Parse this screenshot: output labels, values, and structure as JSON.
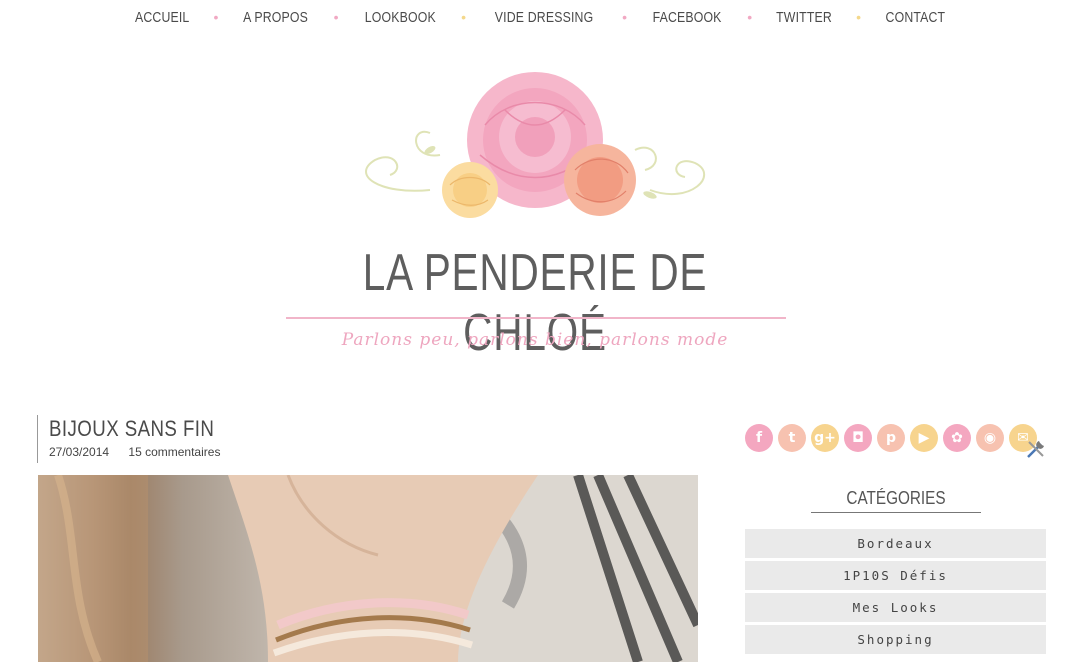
{
  "nav": {
    "items": [
      {
        "label": "ACCUEIL",
        "dot": "pink"
      },
      {
        "label": "A PROPOS",
        "dot": "pink"
      },
      {
        "label": "LOOKBOOK",
        "dot": "yellow"
      },
      {
        "label": "VIDE DRESSING",
        "dot": "pink"
      },
      {
        "label": "FACEBOOK",
        "dot": "pink"
      },
      {
        "label": "TWITTER",
        "dot": "yellow"
      },
      {
        "label": "CONTACT",
        "dot": null
      }
    ],
    "dot_glyph": "•"
  },
  "header": {
    "site_title": "LA PENDERIE DE CHLOÉ",
    "tagline": "Parlons peu, parlons bien, parlons mode"
  },
  "post": {
    "title": "BIJOUX SANS FIN",
    "date": "27/03/2014",
    "comments": "15 commentaires"
  },
  "sidebar": {
    "social": [
      {
        "name": "facebook-icon",
        "glyph": "f",
        "color": "#f4a7c0"
      },
      {
        "name": "twitter-icon",
        "glyph": "t",
        "color": "#f7c2b0"
      },
      {
        "name": "google-plus-icon",
        "glyph": "g+",
        "color": "#f7d48e"
      },
      {
        "name": "instagram-icon",
        "glyph": "◘",
        "color": "#f4a7c0"
      },
      {
        "name": "pinterest-icon",
        "glyph": "p",
        "color": "#f7c2b0"
      },
      {
        "name": "youtube-icon",
        "glyph": "▶",
        "color": "#f7d48e"
      },
      {
        "name": "bloglovin-icon",
        "glyph": "✿",
        "color": "#f4a7c0"
      },
      {
        "name": "rss-icon",
        "glyph": "◉",
        "color": "#f7c2b0"
      },
      {
        "name": "email-icon",
        "glyph": "✉",
        "color": "#f7d48e"
      }
    ],
    "categories_title": "CATÉGORIES",
    "categories": [
      "Bordeaux",
      "1P10S Défis",
      "Mes Looks",
      "Shopping"
    ]
  },
  "colors": {
    "accent_pink": "#f1a9c3",
    "accent_yellow": "#f4d88b",
    "title_gray": "#5e5e5e",
    "category_bg": "#eaeaea"
  }
}
